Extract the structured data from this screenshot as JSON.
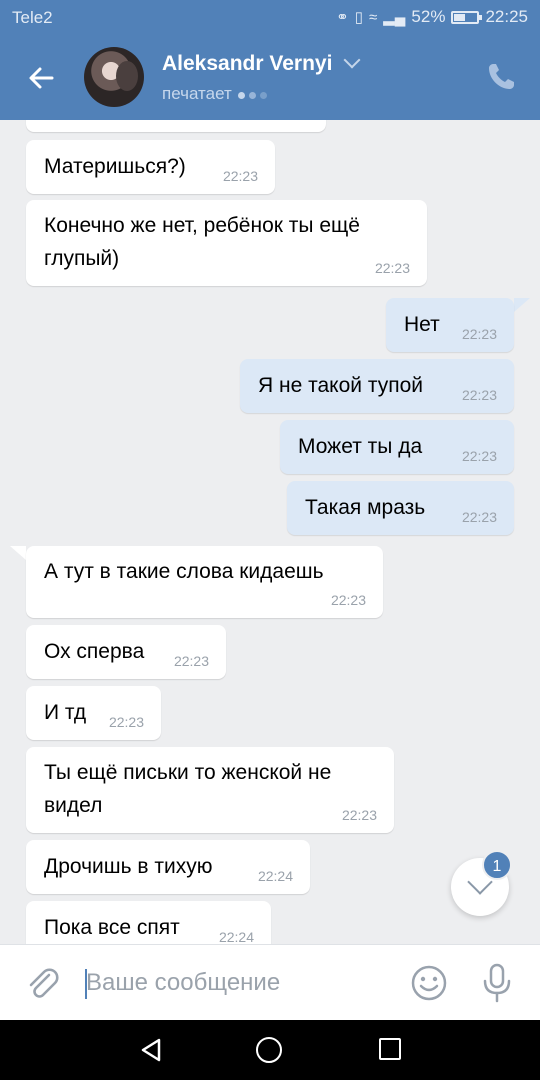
{
  "status_bar": {
    "carrier": "Tele2",
    "battery": "52%",
    "time": "22:25",
    "battery_level": 0.52
  },
  "header": {
    "name": "Aleksandr Vernyi",
    "status": "печатает"
  },
  "messages": [
    {
      "dir": "in",
      "lines": [
        ""
      ],
      "time": "22:23"
    },
    {
      "dir": "in",
      "lines": [
        "Материшься?)"
      ],
      "time": "22:23"
    },
    {
      "dir": "in",
      "lines": [
        "Конечно же нет, ребёнок ты ещё",
        "глупый)"
      ],
      "time": "22:23"
    },
    {
      "dir": "out",
      "lines": [
        "Нет"
      ],
      "time": "22:23"
    },
    {
      "dir": "out",
      "lines": [
        "Я не такой тупой"
      ],
      "time": "22:23"
    },
    {
      "dir": "out",
      "lines": [
        "Может ты да"
      ],
      "time": "22:23"
    },
    {
      "dir": "out",
      "lines": [
        "Такая мразь"
      ],
      "time": "22:23"
    },
    {
      "dir": "in",
      "lines": [
        "А тут в такие слова кидаешь"
      ],
      "time": "22:23"
    },
    {
      "dir": "in",
      "lines": [
        "Ох сперва"
      ],
      "time": "22:23"
    },
    {
      "dir": "in",
      "lines": [
        "И тд"
      ],
      "time": "22:23"
    },
    {
      "dir": "in",
      "lines": [
        "Ты ещё письки то женской не",
        "видел"
      ],
      "time": "22:23"
    },
    {
      "dir": "in",
      "lines": [
        "Дрочишь в тихую"
      ],
      "time": "22:24"
    },
    {
      "dir": "in",
      "lines": [
        "Пока все спят"
      ],
      "time": "22:24"
    }
  ],
  "scroll_down": {
    "badge": "1"
  },
  "composer": {
    "placeholder": "Ваше сообщение",
    "value": ""
  },
  "colors": {
    "header": "#5181b8",
    "incoming": "#ffffff",
    "outgoing": "#dce8f6",
    "background": "#edeef0"
  },
  "icons": [
    "back-arrow-icon",
    "phone-icon",
    "paperclip-icon",
    "smile-icon",
    "microphone-icon",
    "chevron-down-icon"
  ]
}
